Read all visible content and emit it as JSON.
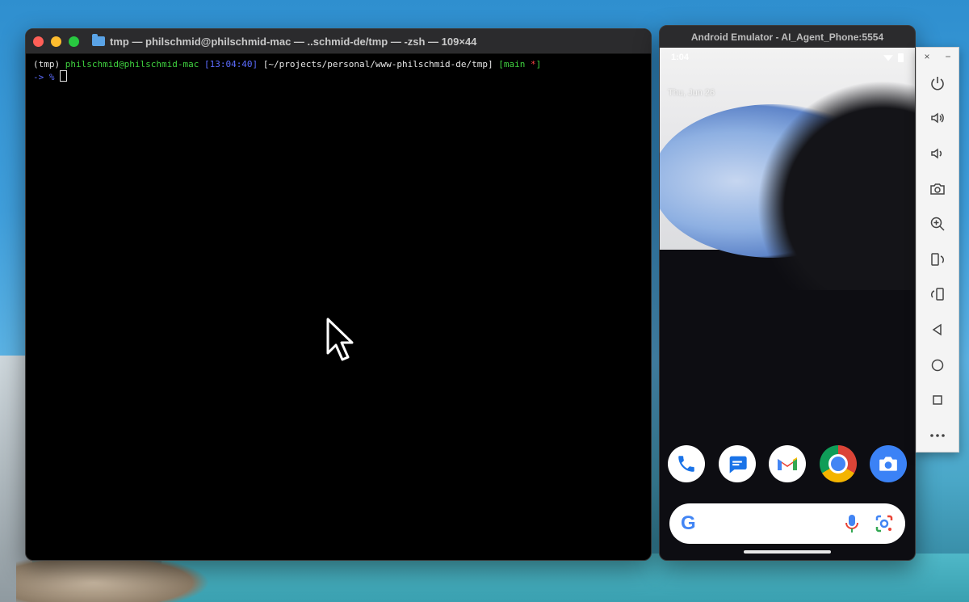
{
  "terminal": {
    "title": "tmp — philschmid@philschmid-mac — ..schmid-de/tmp — -zsh — 109×44",
    "prompt": {
      "env": "(tmp)",
      "user_host": "philschmid@philschmid-mac",
      "time": "[13:04:40]",
      "path": "[~/projects/personal/www-philschmid-de/tmp]",
      "branch": "[main",
      "dirty": "*",
      "branch_close": "]"
    },
    "line2_arrow": "->",
    "line2_symbol": "%"
  },
  "emulator": {
    "title": "Android Emulator - AI_Agent_Phone:5554",
    "status_time": "1:04",
    "date": "Thu, Jun 26",
    "dock_apps": [
      "phone-icon",
      "messages-icon",
      "gmail-icon",
      "chrome-icon",
      "camera-icon"
    ],
    "search": {
      "logo": "G"
    }
  },
  "sidebar": {
    "close": "×",
    "minimize": "−",
    "tools": [
      "power-icon",
      "volume-up-icon",
      "volume-down-icon",
      "camera-icon",
      "zoom-icon",
      "rotate-left-icon",
      "rotate-right-icon",
      "back-icon",
      "home-icon",
      "overview-icon",
      "more-icon"
    ]
  }
}
